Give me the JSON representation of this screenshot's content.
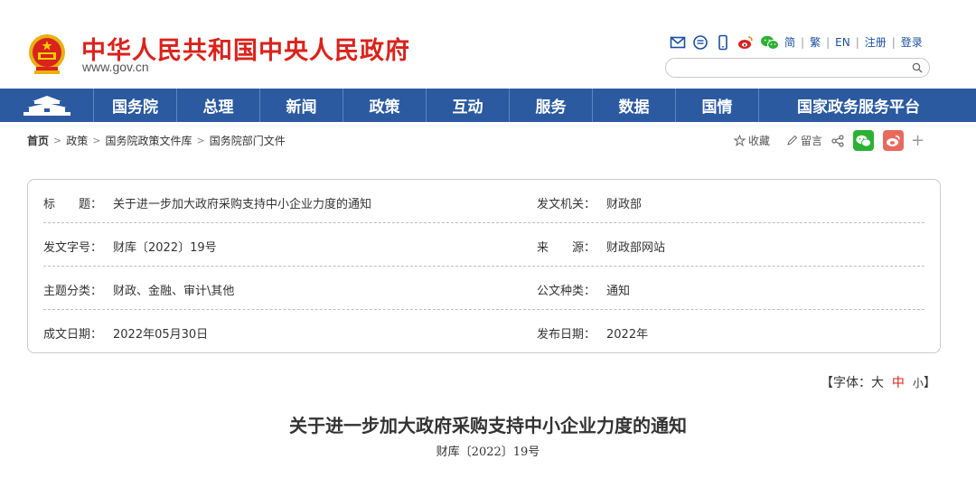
{
  "header": {
    "site_title": "中华人民共和国中央人民政府",
    "site_url": "www.gov.cn",
    "tool_icons": [
      "mail-icon",
      "comment-icon",
      "mobile-icon",
      "weibo-icon",
      "wechat-icon"
    ],
    "lang": [
      "简",
      "繁",
      "EN",
      "注册",
      "登录"
    ],
    "search_placeholder": ""
  },
  "nav": {
    "items": [
      "国务院",
      "总理",
      "新闻",
      "政策",
      "互动",
      "服务",
      "数据",
      "国情"
    ],
    "platform": "国家政务服务平台"
  },
  "breadcrumb": [
    "首页",
    "政策",
    "国务院政策文件库",
    "国务院部门文件"
  ],
  "share": {
    "favorite": "收藏",
    "comment": "留言"
  },
  "info": {
    "title_label": "标　　题：",
    "title_value": "关于进一步加大政府采购支持中小企业力度的通知",
    "issuer_label": "发文机关：",
    "issuer_value": "财政部",
    "docno_label": "发文字号：",
    "docno_value": "财库〔2022〕19号",
    "source_label": "来　　源：",
    "source_value": "财政部网站",
    "topic_label": "主题分类：",
    "topic_value": "财政、金融、审计\\其他",
    "type_label": "公文种类：",
    "type_value": "通知",
    "date_label": "成文日期：",
    "date_value": "2022年05月30日",
    "pub_label": "发布日期：",
    "pub_value": "2022年"
  },
  "fontsize": {
    "open": "【字体：",
    "large": "大",
    "medium": "中",
    "small": "小",
    "close": "】"
  },
  "document": {
    "title": "关于进一步加大政府采购支持中小企业力度的通知",
    "number": "财库〔2022〕19号"
  },
  "colors": {
    "brand_red": "#d9231c",
    "nav_blue": "#2b5aa0",
    "link_blue": "#1a4f9c"
  }
}
